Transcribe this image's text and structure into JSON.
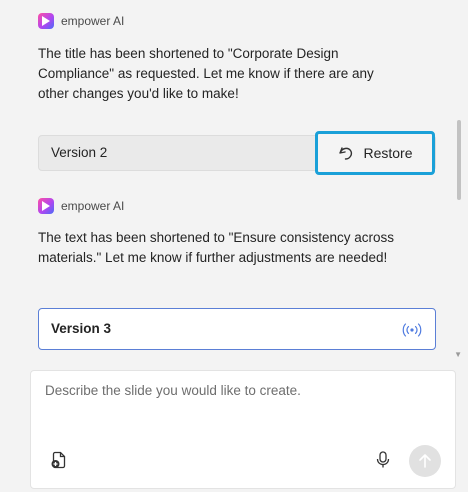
{
  "messages": [
    {
      "sender": "empower AI",
      "text": "The title has been shortened to \"Corporate Design Compliance\" as requested. Let me know if there are any other changes you'd like to make!",
      "version_label": "Version 2",
      "restore_label": "Restore"
    },
    {
      "sender": "empower AI",
      "text": "The text has been shortened to \"Ensure consistency across materials.\" Let me know if further adjustments are needed!",
      "version_label": "Version 3"
    }
  ],
  "composer": {
    "placeholder": "Describe the slide you would like to create."
  },
  "colors": {
    "restore_highlight": "#1aa0d8",
    "active_version_border": "#5b7fd6",
    "live_icon": "#4f7be0"
  },
  "icons": [
    "app-logo-icon",
    "restore-icon",
    "live-icon",
    "add-file-icon",
    "microphone-icon",
    "send-arrow-icon"
  ]
}
